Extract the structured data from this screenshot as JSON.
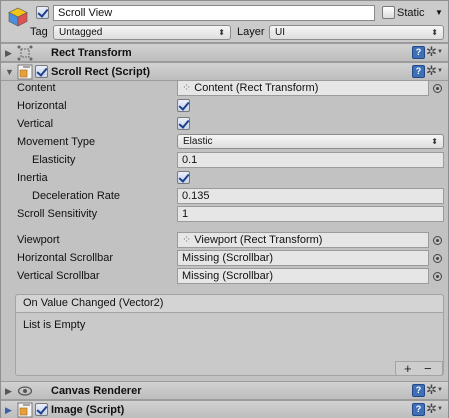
{
  "header": {
    "name": "Scroll View",
    "static_label": "Static",
    "tag_label": "Tag",
    "tag_value": "Untagged",
    "layer_label": "Layer",
    "layer_value": "UI"
  },
  "components": {
    "rect_transform": {
      "title": "Rect Transform"
    },
    "scroll_rect": {
      "title": "Scroll Rect (Script)",
      "props": {
        "content_label": "Content",
        "content_value": "Content (Rect Transform)",
        "horizontal_label": "Horizontal",
        "vertical_label": "Vertical",
        "movement_type_label": "Movement Type",
        "movement_type_value": "Elastic",
        "elasticity_label": "Elasticity",
        "elasticity_value": "0.1",
        "inertia_label": "Inertia",
        "deceleration_label": "Deceleration Rate",
        "deceleration_value": "0.135",
        "scroll_sensitivity_label": "Scroll Sensitivity",
        "scroll_sensitivity_value": "1",
        "viewport_label": "Viewport",
        "viewport_value": "Viewport (Rect Transform)",
        "h_scrollbar_label": "Horizontal Scrollbar",
        "h_scrollbar_value": "Missing (Scrollbar)",
        "v_scrollbar_label": "Vertical Scrollbar",
        "v_scrollbar_value": "Missing (Scrollbar)"
      },
      "event": {
        "title": "On Value Changed (Vector2)",
        "empty_text": "List is Empty",
        "add_symbol": "+",
        "remove_symbol": "−"
      }
    },
    "canvas_renderer": {
      "title": "Canvas Renderer"
    },
    "image": {
      "title": "Image (Script)"
    }
  },
  "icons": {
    "help": "?",
    "gear": "✲"
  },
  "colors": {
    "background": "#c2c2c2",
    "checkmark": "#1f3f8c",
    "help_icon": "#3f6fb5"
  }
}
